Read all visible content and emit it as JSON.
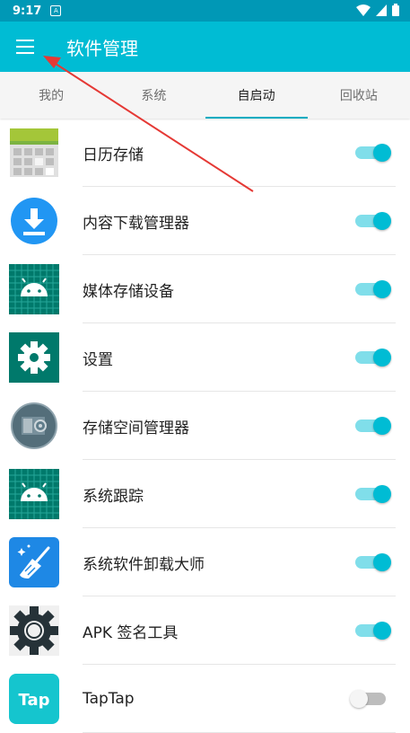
{
  "status_bar": {
    "time": "9:17",
    "notification_glyph": "A"
  },
  "app_bar": {
    "title": "软件管理"
  },
  "tabs": [
    {
      "label": "我的",
      "active": false
    },
    {
      "label": "系统",
      "active": false
    },
    {
      "label": "自启动",
      "active": true
    },
    {
      "label": "回收站",
      "active": false
    }
  ],
  "apps": [
    {
      "name": "日历存储",
      "enabled": true,
      "icon": "calendar-icon"
    },
    {
      "name": "内容下载管理器",
      "enabled": true,
      "icon": "download-icon"
    },
    {
      "name": "媒体存储设备",
      "enabled": true,
      "icon": "android-icon"
    },
    {
      "name": "设置",
      "enabled": true,
      "icon": "gear-icon"
    },
    {
      "name": "存储空间管理器",
      "enabled": true,
      "icon": "storage-icon"
    },
    {
      "name": "系统跟踪",
      "enabled": true,
      "icon": "android-icon"
    },
    {
      "name": "系统软件卸载大师",
      "enabled": true,
      "icon": "broom-icon"
    },
    {
      "name": "APK 签名工具",
      "enabled": true,
      "icon": "cog-icon"
    },
    {
      "name": "TapTap",
      "enabled": false,
      "icon": "taptap-icon"
    }
  ],
  "taptap_logo_text": "Tap",
  "colors": {
    "accent": "#00bcd4",
    "status_bar": "#0098b6",
    "arrow": "#e53935"
  }
}
